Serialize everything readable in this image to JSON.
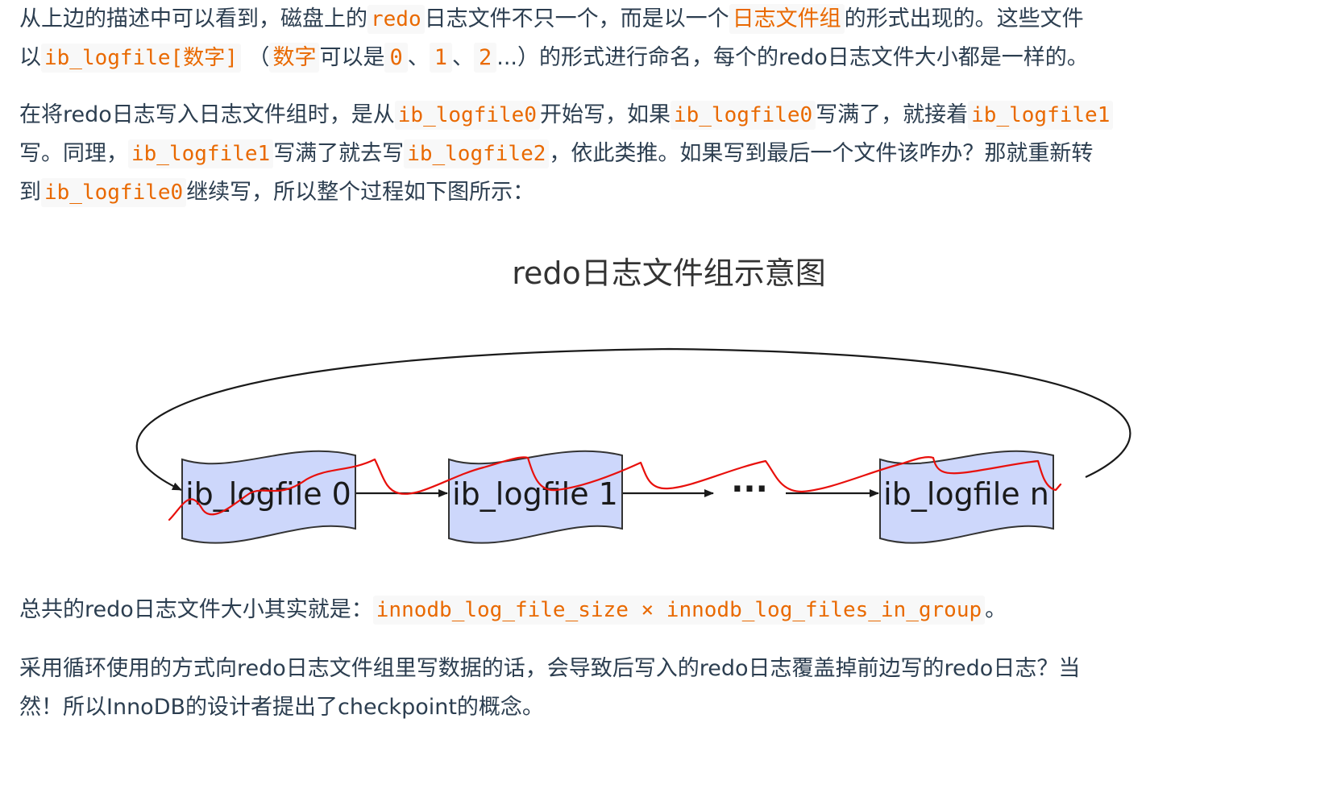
{
  "para1": {
    "t1": "从上边的描述中可以看到，磁盘上的",
    "c1": "redo",
    "t2": "日志文件不只一个，而是以一个",
    "c2": "日志文件组",
    "t3": "的形式出现的。这些文件",
    "t4": "以",
    "c3": "ib_logfile[",
    "c3b": "数字",
    "c3c": "]",
    "t5": "（",
    "c4": "数字",
    "t6": "可以是",
    "n0": "0",
    "sep1": "、",
    "n1": "1",
    "sep2": "、",
    "n2": "2",
    "t7": "...）的形式进行命名，每个的redo日志文件大小都是一样的。"
  },
  "para2": {
    "t1": "在将redo日志写入日志文件组时，是从",
    "c1": "ib_logfile0",
    "t2": "开始写，如果",
    "c2": "ib_logfile0",
    "t3": "写满了，就接着",
    "c3": "ib_logfile1",
    "t4": "写。同理，",
    "c4": "ib_logfile1",
    "t5": "写满了就去写",
    "c5": "ib_logfile2",
    "t6": "，依此类推。如果写到最后一个文件该咋办？那就重新转",
    "t7": "到",
    "c6": "ib_logfile0",
    "t8": "继续写，所以整个过程如下图所示："
  },
  "diagram": {
    "title": "redo日志文件组示意图",
    "files": [
      "ib_logfile 0",
      "ib_logfile 1",
      "ib_logfile n"
    ],
    "ellipsis": "···",
    "colors": {
      "file_fill": "#cdd7fb",
      "file_stroke": "#333333",
      "arrow": "#1a1a1a",
      "annotation": "#e8100c"
    }
  },
  "para4": {
    "t1": "总共的redo日志文件大小其实就是：",
    "c1": "innodb_log_file_size × innodb_log_files_in_group",
    "t2": "。"
  },
  "para5": {
    "line1": "采用循环使用的方式向redo日志文件组里写数据的话，会导致后写入的redo日志覆盖掉前边写的redo日志？当",
    "line2": "然！所以InnoDB的设计者提出了checkpoint的概念。"
  },
  "colors": {
    "text": "#2c3e50",
    "code": "#e96900",
    "code_bg": "#f8f8f8"
  }
}
